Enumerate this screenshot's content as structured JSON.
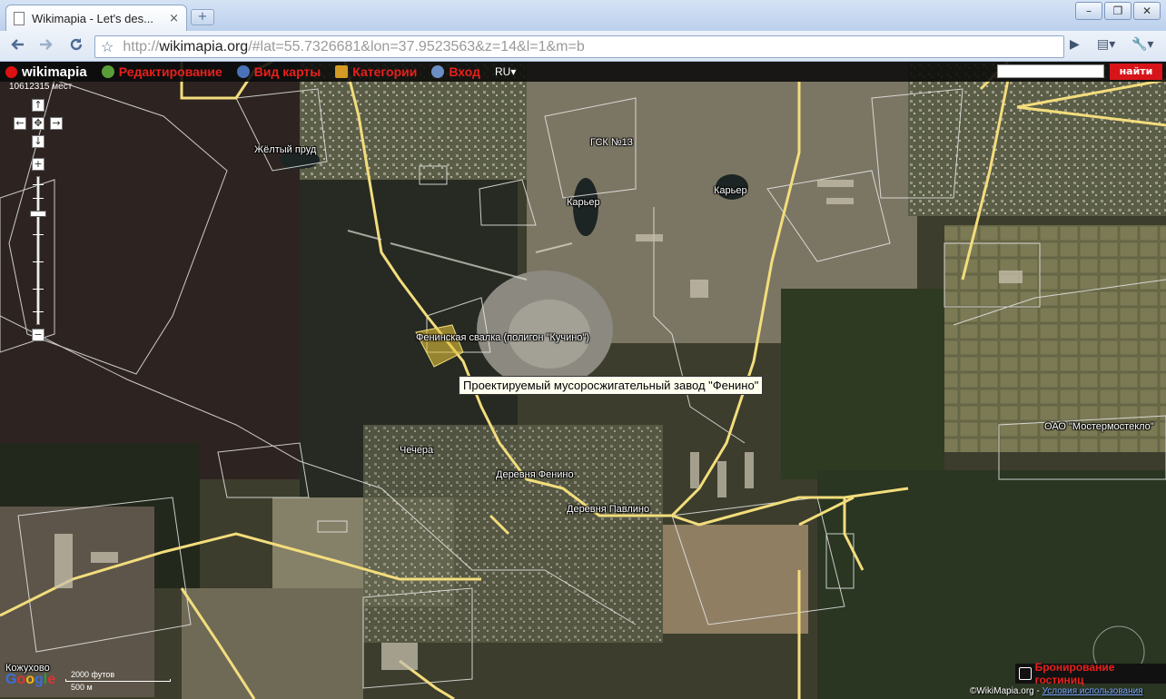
{
  "browser": {
    "tab_title": "Wikimapia - Let's des...",
    "tab_close": "×",
    "new_tab": "+",
    "minimize": "–",
    "restore": "❐",
    "close": "✕",
    "url_scheme": "http://",
    "url_host": "wikimapia.org",
    "url_path": "/#lat=55.7326681&lon=37.9523563&z=14&l=1&m=b"
  },
  "wikimapia": {
    "logo": "wikimapia",
    "menu": [
      {
        "label": "Редактирование"
      },
      {
        "label": "Вид карты"
      },
      {
        "label": "Категории"
      },
      {
        "label": "Вход"
      }
    ],
    "lang": "RU",
    "search_value": "",
    "find_button": "найти",
    "visitors": "10612315 мест"
  },
  "map": {
    "labels": [
      {
        "text": "Жёлтый пруд"
      },
      {
        "text": "ГСК №13"
      },
      {
        "text": "Карьер"
      },
      {
        "text": "Карьер"
      },
      {
        "text": "Фенинская свалка (полигон \"Кучино\")"
      },
      {
        "text": "Чечера"
      },
      {
        "text": "Деревня Фенино"
      },
      {
        "text": "Деревня Павлино"
      },
      {
        "text": "ОАО \"Мостермостекло\""
      },
      {
        "text": "Кожухово"
      }
    ],
    "tooltip": "Проектируемый мусоросжигательный завод \"Фенино\"",
    "zoom_in": "+",
    "zoom_out": "−",
    "pan_up": "↑",
    "pan_down": "↓",
    "pan_left": "←",
    "pan_right": "→",
    "pan_center": "✥",
    "scale_top": "2000 футов",
    "scale_bottom": "500 м",
    "google": [
      "G",
      "o",
      "o",
      "g",
      "l",
      "e"
    ],
    "hotel_booking": "Бронирование гостиниц",
    "copyright_prefix": "©WikiMapia.org - ",
    "copyright_terms": "Условия использования"
  }
}
